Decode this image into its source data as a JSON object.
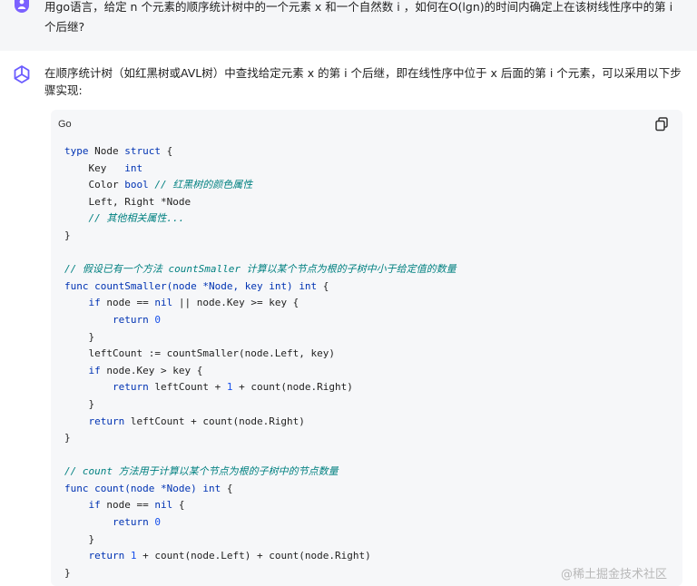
{
  "user_message": {
    "avatar_icon": "user-icon",
    "text": "用go语言，给定 n 个元素的顺序统计树中的一个元素 x 和一个自然数 i ，如何在O(lgn)的时间内确定上在该树线性序中的第 i 个后继?"
  },
  "assistant_message": {
    "avatar_icon": "assistant-logo-icon",
    "text": "在顺序统计树（如红黑树或AVL树）中查找给定元素 x 的第 i 个后继，即在线性序中位于 x 后面的第 i 个元素，可以采用以下步骤实现:"
  },
  "code_block": {
    "language": "Go",
    "copy_icon": "copy-icon",
    "lines": [
      [
        [
          "kw",
          "type"
        ],
        [
          "pl",
          " Node "
        ],
        [
          "kw",
          "struct"
        ],
        [
          "pl",
          " {"
        ]
      ],
      [
        [
          "pl",
          "    Key   "
        ],
        [
          "kw",
          "int"
        ]
      ],
      [
        [
          "pl",
          "    Color "
        ],
        [
          "kw",
          "bool"
        ],
        [
          "pl",
          " "
        ],
        [
          "cm",
          "// 红黑树的颜色属性"
        ]
      ],
      [
        [
          "pl",
          "    Left, Right *Node"
        ]
      ],
      [
        [
          "pl",
          "    "
        ],
        [
          "cm",
          "// 其他相关属性..."
        ]
      ],
      [
        [
          "pl",
          "}"
        ]
      ],
      [
        [
          "pl",
          ""
        ]
      ],
      [
        [
          "cm",
          "// 假设已有一个方法 countSmaller 计算以某个节点为根的子树中小于给定值的数量"
        ]
      ],
      [
        [
          "kw",
          "func"
        ],
        [
          "pl",
          " "
        ],
        [
          "fn",
          "countSmaller"
        ],
        [
          "kw",
          "(node *Node, key int)"
        ],
        [
          "pl",
          " "
        ],
        [
          "kw",
          "int"
        ],
        [
          "pl",
          " {"
        ]
      ],
      [
        [
          "pl",
          "    "
        ],
        [
          "kw",
          "if"
        ],
        [
          "pl",
          " node == "
        ],
        [
          "kw",
          "nil"
        ],
        [
          "pl",
          " || node.Key >= key {"
        ]
      ],
      [
        [
          "pl",
          "        "
        ],
        [
          "kw",
          "return"
        ],
        [
          "pl",
          " "
        ],
        [
          "num",
          "0"
        ]
      ],
      [
        [
          "pl",
          "    }"
        ]
      ],
      [
        [
          "pl",
          "    leftCount := countSmaller(node.Left, key)"
        ]
      ],
      [
        [
          "pl",
          "    "
        ],
        [
          "kw",
          "if"
        ],
        [
          "pl",
          " node.Key > key {"
        ]
      ],
      [
        [
          "pl",
          "        "
        ],
        [
          "kw",
          "return"
        ],
        [
          "pl",
          " leftCount + "
        ],
        [
          "num",
          "1"
        ],
        [
          "pl",
          " + count(node.Right)"
        ]
      ],
      [
        [
          "pl",
          "    }"
        ]
      ],
      [
        [
          "pl",
          "    "
        ],
        [
          "kw",
          "return"
        ],
        [
          "pl",
          " leftCount + count(node.Right)"
        ]
      ],
      [
        [
          "pl",
          "}"
        ]
      ],
      [
        [
          "pl",
          ""
        ]
      ],
      [
        [
          "cm",
          "// count 方法用于计算以某个节点为根的子树中的节点数量"
        ]
      ],
      [
        [
          "kw",
          "func"
        ],
        [
          "pl",
          " "
        ],
        [
          "fn",
          "count"
        ],
        [
          "kw",
          "(node *Node)"
        ],
        [
          "pl",
          " "
        ],
        [
          "kw",
          "int"
        ],
        [
          "pl",
          " {"
        ]
      ],
      [
        [
          "pl",
          "    "
        ],
        [
          "kw",
          "if"
        ],
        [
          "pl",
          " node == "
        ],
        [
          "kw",
          "nil"
        ],
        [
          "pl",
          " {"
        ]
      ],
      [
        [
          "pl",
          "        "
        ],
        [
          "kw",
          "return"
        ],
        [
          "pl",
          " "
        ],
        [
          "num",
          "0"
        ]
      ],
      [
        [
          "pl",
          "    }"
        ]
      ],
      [
        [
          "pl",
          "    "
        ],
        [
          "kw",
          "return"
        ],
        [
          "pl",
          " "
        ],
        [
          "num",
          "1"
        ],
        [
          "pl",
          " + count(node.Left) + count(node.Right)"
        ]
      ],
      [
        [
          "pl",
          "}"
        ]
      ]
    ]
  },
  "watermark": "@稀土掘金技术社区",
  "colors": {
    "keyword": "#0033b3",
    "comment": "#008080",
    "number": "#1750eb",
    "user_row_bg": "#f5f6f8",
    "code_bg": "#f6f7f9",
    "avatar": "#7b61ff"
  }
}
